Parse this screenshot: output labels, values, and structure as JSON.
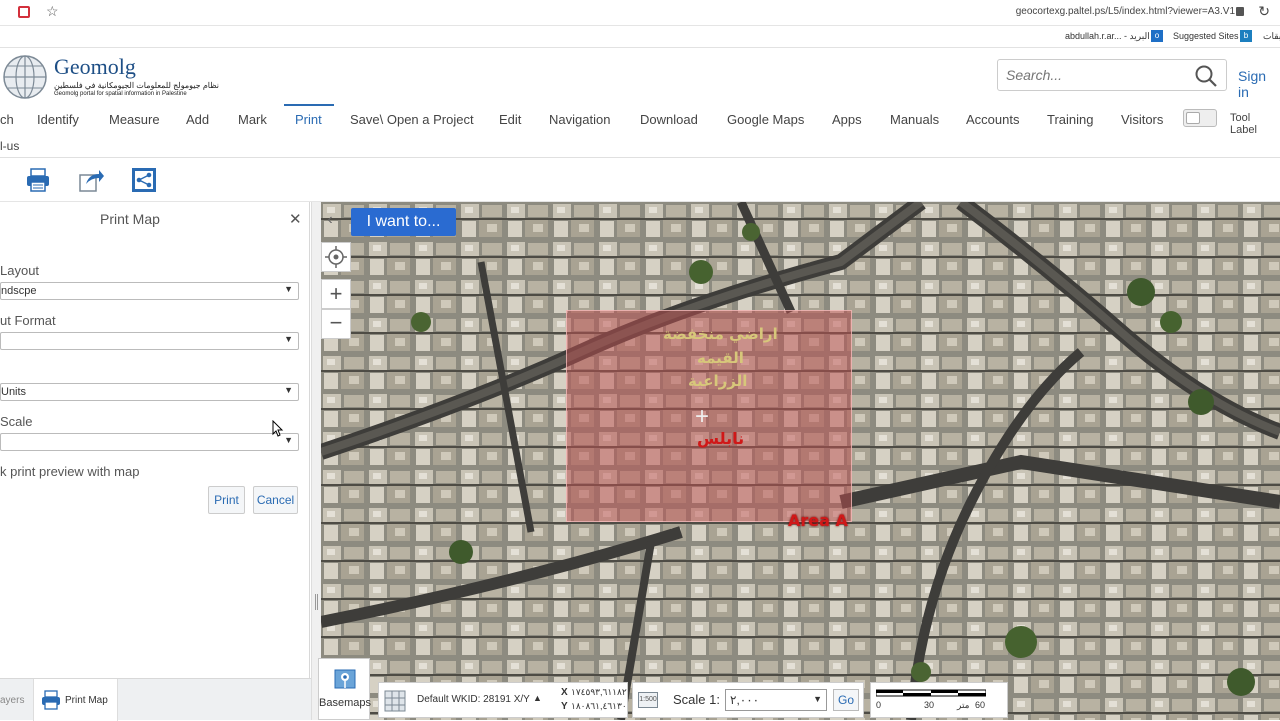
{
  "browser": {
    "url": "geocortexg.paltel.ps/L5/index.html?viewer=A3.V1",
    "favorites": [
      {
        "label": "abdullah.r.ar... - البريد"
      },
      {
        "label": "Suggested Sites"
      },
      {
        "label": "بقات"
      }
    ]
  },
  "header": {
    "title": "Geomolg",
    "subtitle_ar": "نظام جيومولج للمعلومات الجيومكانية في فلسطين",
    "subtitle_en": "Geomolg portal for spatial information in Palestine",
    "search_placeholder": "Search...",
    "signin": "Sign in"
  },
  "menu": {
    "items": [
      "ch",
      "Identify",
      "Measure",
      "Add",
      "Mark",
      "Print",
      "Save\\ Open a Project",
      "Edit",
      "Navigation",
      "Download",
      "Google Maps",
      "Apps",
      "Manuals",
      "Accounts",
      "Training",
      "Visitors"
    ],
    "active": "Print",
    "second_row": "l-us",
    "tool_labels": "Tool Label"
  },
  "panel": {
    "title": "Print Map",
    "layout_label": "Layout",
    "layout_value": "ndscpe",
    "format_label": "ut Format",
    "format_value": "",
    "units_value": "Units",
    "scale_label": "Scale",
    "scale_value": "",
    "preview_text": "k print preview with map",
    "print_button": "Print",
    "cancel_button": "Cancel"
  },
  "tabs": {
    "layers": "ayers",
    "print_map": "Print Map"
  },
  "map": {
    "i_want_to": "I want to...",
    "label_ar_1": "اراضي منخفضة",
    "label_ar_2": "القيمه",
    "label_ar_3": "الزراعية",
    "label_ar_4": "نابلس",
    "area_label": "Area A",
    "basemaps": "Basemaps",
    "wkid": "Default WKID: 28191 X/Y",
    "coord_x_label": "X",
    "coord_x": "١٧٤٥٩٣,٦١١٨٢",
    "coord_y_label": "Y",
    "coord_y": "١٨٠٨٦١,٤٦١٣٠",
    "scale_label": "Scale 1:",
    "scale_value": "٢,٠٠٠",
    "go_button": "Go",
    "scalebar_ticks": [
      "0",
      "30",
      "60"
    ],
    "scalebar_unit": "متر"
  },
  "colors": {
    "accent": "#2a6bb3",
    "i_want_to_bg": "#2a6bd1",
    "area_label": "#d01818",
    "print_overlay": "#be5050"
  }
}
